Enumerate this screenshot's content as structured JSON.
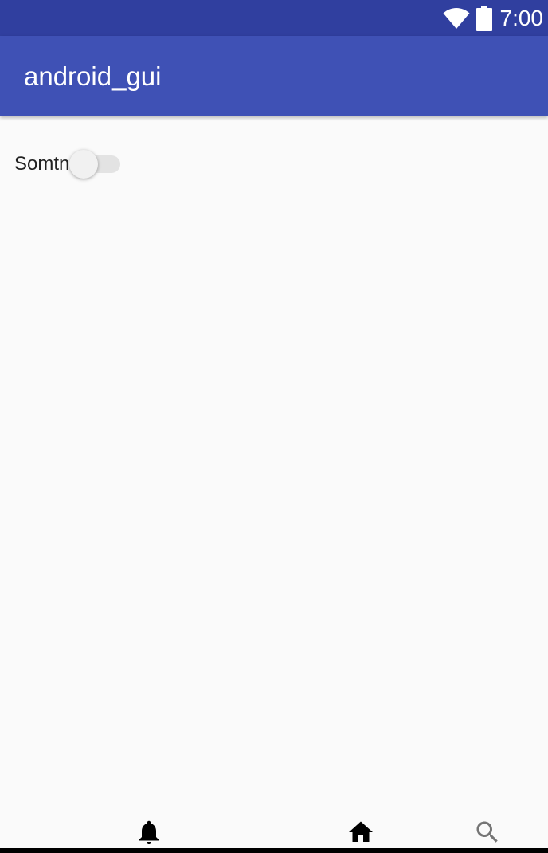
{
  "status_bar": {
    "time": "7:00",
    "icons": [
      "wifi-icon",
      "battery-icon"
    ]
  },
  "app_bar": {
    "title": "android_gui"
  },
  "content": {
    "switch_label": "Somtn",
    "switch_checked": false
  },
  "bottom_nav": {
    "items": [
      {
        "icon": "bell-icon",
        "color": "#000000"
      },
      {
        "icon": "home-icon",
        "color": "#000000"
      },
      {
        "icon": "search-icon",
        "color": "#757575"
      }
    ]
  },
  "colors": {
    "status_bar": "#303f9f",
    "app_bar": "#3f51b5",
    "background": "#fafafa"
  }
}
